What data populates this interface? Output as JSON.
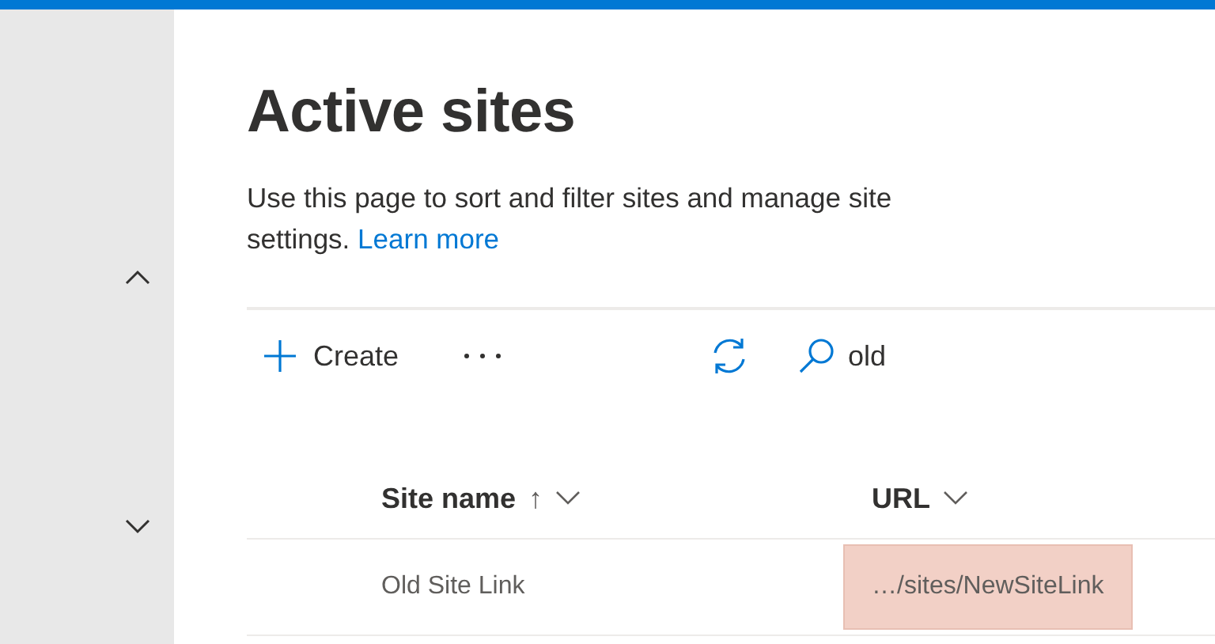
{
  "page": {
    "title": "Active sites",
    "description": "Use this page to sort and filter sites and manage site settings.",
    "learn_more": "Learn more"
  },
  "toolbar": {
    "create": "Create",
    "search_value": "old"
  },
  "table": {
    "columns": [
      {
        "label": "Site name",
        "sort_indicator": "↑"
      },
      {
        "label": "URL"
      }
    ],
    "rows": [
      {
        "site_name": "Old Site Link",
        "url": "…/sites/NewSiteLink",
        "url_highlighted": true
      }
    ]
  }
}
